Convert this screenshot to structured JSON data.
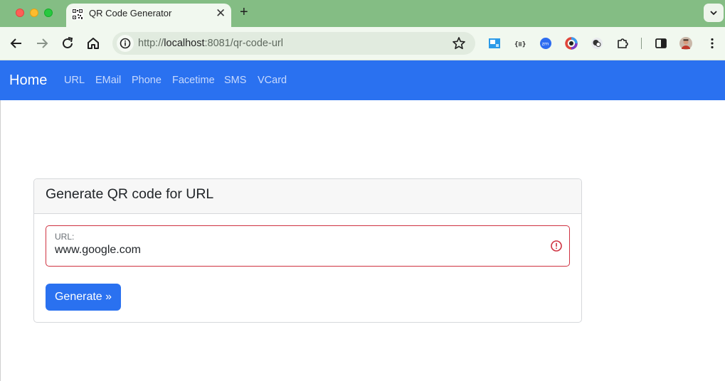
{
  "tab": {
    "title": "QR Code Generator"
  },
  "omnibox": {
    "url_prefix": "http://",
    "url_host": "localhost",
    "url_rest": ":8081/qr-code-url"
  },
  "nav": {
    "brand": "Home",
    "links": [
      "URL",
      "EMail",
      "Phone",
      "Facetime",
      "SMS",
      "VCard"
    ]
  },
  "card": {
    "title": "Generate QR code for URL",
    "field_label": "URL:",
    "field_value": "www.google.com",
    "button_label": "Generate »"
  },
  "colors": {
    "navbar": "#2a71f0",
    "tabstrip": "#84bd84",
    "error": "#cf3241"
  }
}
